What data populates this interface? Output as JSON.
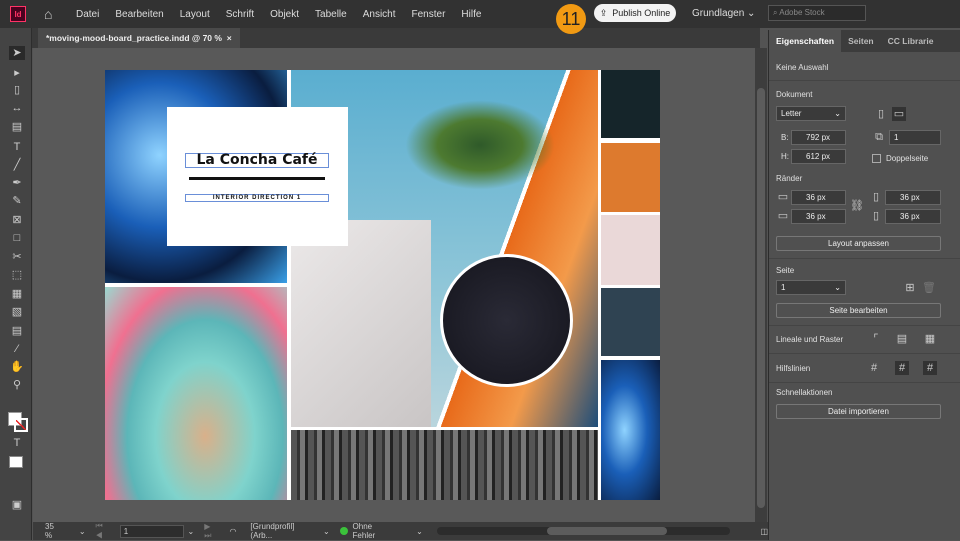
{
  "app": {
    "logo": "Id",
    "step_badge": "11",
    "publish": "Publish Online",
    "workspace": "Grundlagen",
    "search_placeholder": "Adobe Stock"
  },
  "menu": [
    "Datei",
    "Bearbeiten",
    "Layout",
    "Schrift",
    "Objekt",
    "Tabelle",
    "Ansicht",
    "Fenster",
    "Hilfe"
  ],
  "document_tab": {
    "title": "*moving-mood-board_practice.indd @ 70 %",
    "close": "×"
  },
  "artwork": {
    "title": "La Concha Café",
    "subtitle": "INTERIOR DIRECTION 1"
  },
  "status": {
    "zoom": "35 %",
    "page": "1",
    "profile": "[Grundprofil] (Arb...",
    "errors": "Ohne Fehler",
    "error_color": "#3bc23b"
  },
  "panel": {
    "tabs": [
      "Eigenschaften",
      "Seiten",
      "CC Librarie"
    ],
    "selection": "Keine Auswahl",
    "document_label": "Dokument",
    "preset": "Letter",
    "width_label": "B:",
    "width": "792 px",
    "height_label": "H:",
    "height": "612 px",
    "pages": "1",
    "facing_pages": "Doppelseite",
    "margins_label": "Ränder",
    "margins": {
      "top": "36 px",
      "bottom": "36 px",
      "left": "36 px",
      "right": "36 px"
    },
    "adjust_layout": "Layout anpassen",
    "page_label": "Seite",
    "page": "1",
    "edit_page": "Seite bearbeiten",
    "rulers": "Lineale und Raster",
    "guides": "Hilfslinien",
    "quick_actions": "Schnellaktionen",
    "import": "Datei importieren"
  }
}
